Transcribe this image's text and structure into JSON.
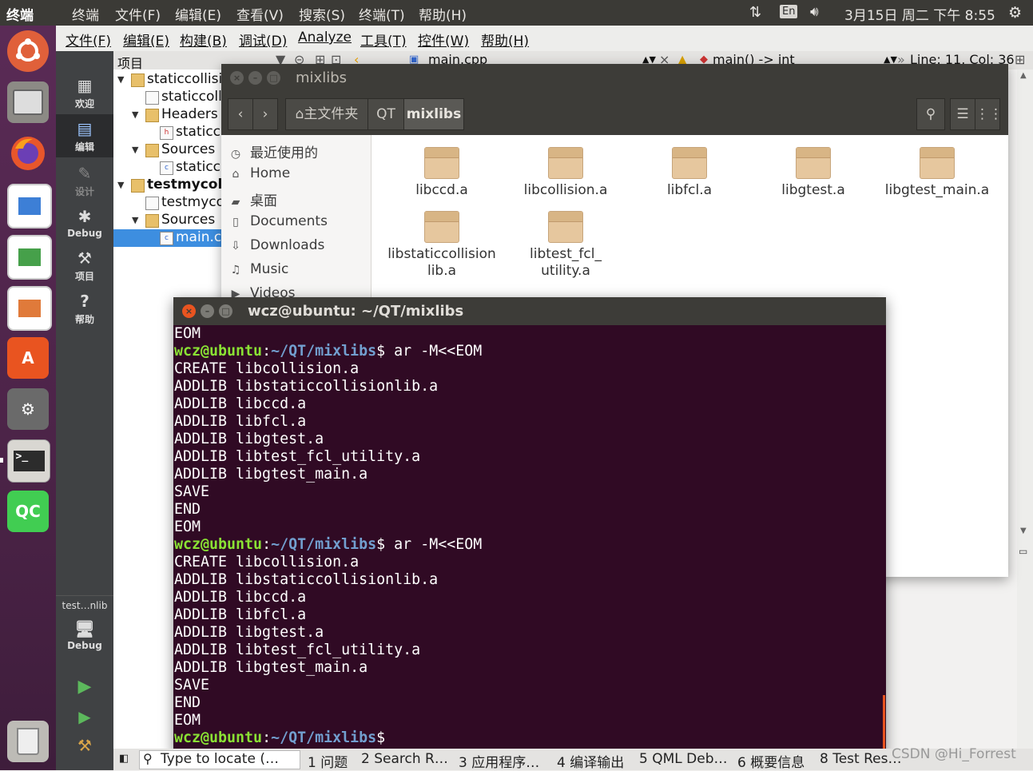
{
  "topbar": {
    "app_name": "终端",
    "menus": [
      "终端",
      "文件(F)",
      "编辑(E)",
      "查看(V)",
      "搜索(S)",
      "终端(T)",
      "帮助(H)"
    ],
    "input_method": "En",
    "datetime": "3月15日 周二 下午 8:55"
  },
  "qt_menu": [
    "文件(F)",
    "编辑(E)",
    "构建(B)",
    "调试(D)",
    "Analyze",
    "工具(T)",
    "控件(W)",
    "帮助(H)"
  ],
  "modes": [
    "欢迎",
    "编辑",
    "设计",
    "Debug",
    "项目",
    "帮助"
  ],
  "kit": {
    "project": "test…nlib",
    "config": "Debug"
  },
  "project_panel": {
    "title": "项目",
    "tree": [
      "staticcollisi",
      "staticcoll",
      "Headers",
      "staticc",
      "Sources",
      "staticc",
      "testmycolli",
      "testmyco",
      "Sources",
      "main.c"
    ]
  },
  "editor_toolbar": {
    "file": "main.cpp",
    "symbol": "main() -> int",
    "position": "Line: 11, Col: 36"
  },
  "file_manager": {
    "title": "mixlibs",
    "path": [
      "主文件夹",
      "QT",
      "mixlibs"
    ],
    "sidebar": [
      "最近使用的",
      "Home",
      "桌面",
      "Documents",
      "Downloads",
      "Music",
      "Videos"
    ],
    "files": [
      "libccd.a",
      "libcollision.a",
      "libfcl.a",
      "libgtest.a",
      "libgtest_main.a",
      "libstaticcollisionlib.a",
      "libtest_fcl_utility.a"
    ],
    "file_labels_line1": [
      "libccd.a",
      "libcollision.a",
      "libfcl.a",
      "libgtest.a",
      "libgtest_main.a",
      "libstaticcollision",
      "libtest_fcl_"
    ],
    "file_labels_line2": [
      "",
      "",
      "",
      "",
      "",
      "lib.a",
      "utility.a"
    ]
  },
  "terminal": {
    "title": "wcz@ubuntu: ~/QT/mixlibs",
    "prompt_user": "wcz@ubuntu",
    "prompt_path": "~/QT/mixlibs",
    "command": " ar -M<<EOM",
    "lines": [
      "EOM",
      "CREATE libcollision.a",
      "ADDLIB libstaticcollisionlib.a",
      "ADDLIB libccd.a",
      "ADDLIB libfcl.a",
      "ADDLIB libgtest.a",
      "ADDLIB libtest_fcl_utility.a",
      "ADDLIB libgtest_main.a",
      "SAVE",
      "END",
      "EOM"
    ]
  },
  "status_bar": {
    "locate_placeholder": "Type to locate (…",
    "tabs": [
      "1 问题",
      "2 Search R…",
      "3 应用程序…",
      "4 编译输出",
      "5 QML Deb…",
      "6 概要信息",
      "8 Test Res…"
    ]
  },
  "watermark": "CSDN @Hi_Forrest",
  "colors": {
    "launcher": "#4b2347",
    "terminal_bg": "#300a24",
    "prompt_user": "#8ae234",
    "prompt_path": "#729fcf",
    "qt_modebar": "#404244",
    "selection": "#3d8ee0"
  }
}
